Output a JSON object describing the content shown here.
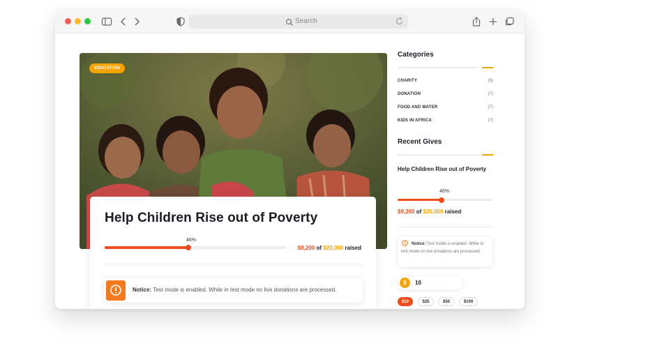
{
  "browser": {
    "search_placeholder": "Search"
  },
  "hero": {
    "category_badge": "EDUCATION"
  },
  "campaign": {
    "title": "Help Children Rise out of Poverty",
    "progress_percent_label": "46%",
    "progress_fraction": 0.46,
    "raised_amount": "$9,200",
    "of_text": "of",
    "goal_amount": "$20,000",
    "raised_text": "raised"
  },
  "notice": {
    "label": "Notice:",
    "message": "Test mode is enabled. While in test mode no live donations are processed."
  },
  "sidebar": {
    "categories_heading": "Categories",
    "categories": [
      {
        "name": "CHARITY",
        "count": "(5)"
      },
      {
        "name": "DONATION",
        "count": "(7)"
      },
      {
        "name": "FOOD AND WATER",
        "count": "(7)"
      },
      {
        "name": "KIDS IN AFRICA",
        "count": "(7)"
      }
    ],
    "recent_heading": "Recent Gives",
    "recent": {
      "title": "Help Children Rise out of Poverty",
      "progress_percent_label": "46%",
      "progress_fraction": 0.46,
      "raised_amount": "$9,200",
      "of_text": "of",
      "goal_amount": "$20,000",
      "raised_text": "raised"
    },
    "notice": {
      "label": "Notice:",
      "message": "Test mode is enabled. While in test mode no live donations are processed."
    },
    "donation": {
      "currency_symbol": "$",
      "amount_value": "10",
      "preset_amounts": [
        "$10",
        "$25",
        "$50",
        "$100"
      ],
      "selected_preset": "$10"
    }
  },
  "colors": {
    "accent_orange": "#ee4d1d",
    "accent_gold": "#f5a300",
    "notice_orange": "#f47b20"
  }
}
